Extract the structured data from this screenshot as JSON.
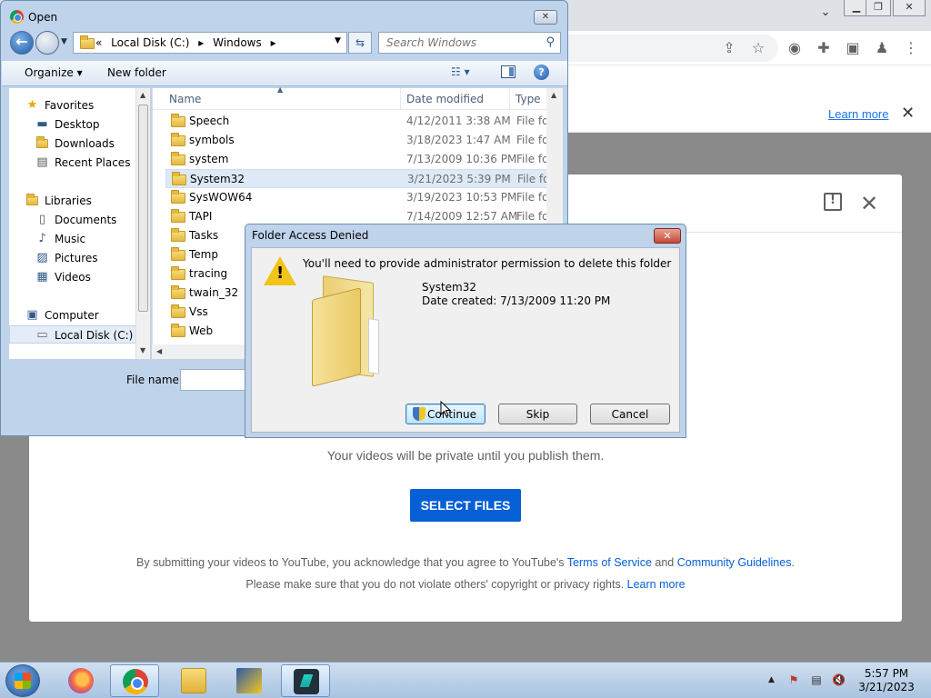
{
  "open_dialog": {
    "title": "Open",
    "address_path": [
      "«",
      "Local Disk (C:)",
      "▸",
      "Windows",
      "▸"
    ],
    "search_placeholder": "Search Windows",
    "toolbar": {
      "organize": "Organize ▾",
      "new_folder": "New folder"
    },
    "nav": {
      "favorites": "Favorites",
      "desktop": "Desktop",
      "downloads": "Downloads",
      "recent_places": "Recent Places",
      "libraries": "Libraries",
      "documents": "Documents",
      "music": "Music",
      "pictures": "Pictures",
      "videos": "Videos",
      "computer": "Computer",
      "local_disk": "Local Disk (C:)"
    },
    "columns": {
      "name": "Name",
      "date": "Date modified",
      "type": "Type"
    },
    "files": [
      {
        "name": "Speech",
        "date": "4/12/2011 3:38 AM",
        "type": "File fol"
      },
      {
        "name": "symbols",
        "date": "3/18/2023 1:47 AM",
        "type": "File fol"
      },
      {
        "name": "system",
        "date": "7/13/2009 10:36 PM",
        "type": "File fol"
      },
      {
        "name": "System32",
        "date": "3/21/2023 5:39 PM",
        "type": "File fol"
      },
      {
        "name": "SysWOW64",
        "date": "3/19/2023 10:53 PM",
        "type": "File fol"
      },
      {
        "name": "TAPI",
        "date": "7/14/2009 12:57 AM",
        "type": "File fol"
      },
      {
        "name": "Tasks",
        "date": "",
        "type": ""
      },
      {
        "name": "Temp",
        "date": "",
        "type": ""
      },
      {
        "name": "tracing",
        "date": "",
        "type": ""
      },
      {
        "name": "twain_32",
        "date": "",
        "type": ""
      },
      {
        "name": "Vss",
        "date": "",
        "type": ""
      },
      {
        "name": "Web",
        "date": "",
        "type": ""
      }
    ],
    "filename_label": "File name:"
  },
  "denied_dialog": {
    "title": "Folder Access Denied",
    "message": "You'll need to provide administrator permission to delete this folder",
    "folder_name": "System32",
    "date_created": "Date created: 7/13/2009 11:20 PM",
    "buttons": {
      "continue": "Continue",
      "skip": "Skip",
      "cancel": "Cancel"
    }
  },
  "browser": {
    "learn_more": "Learn more"
  },
  "upload": {
    "private_note": "Your videos will be private until you publish them.",
    "select_files": "SELECT FILES",
    "terms_prefix": "By submitting your videos to YouTube, you acknowledge that you agree to YouTube's ",
    "terms_link": "Terms of Service",
    "terms_and": " and ",
    "guidelines_link": "Community Guidelines",
    "terms_suffix": ".",
    "privacy_prefix": "Please make sure that you do not violate others' copyright or privacy rights. ",
    "privacy_link": "Learn more"
  },
  "taskbar": {
    "time": "5:57 PM",
    "date": "3/21/2023"
  },
  "colors": {
    "youtube_blue": "#065fd4",
    "chrome_link": "#1a73e8",
    "win7_frame": "#bfd3ea"
  }
}
